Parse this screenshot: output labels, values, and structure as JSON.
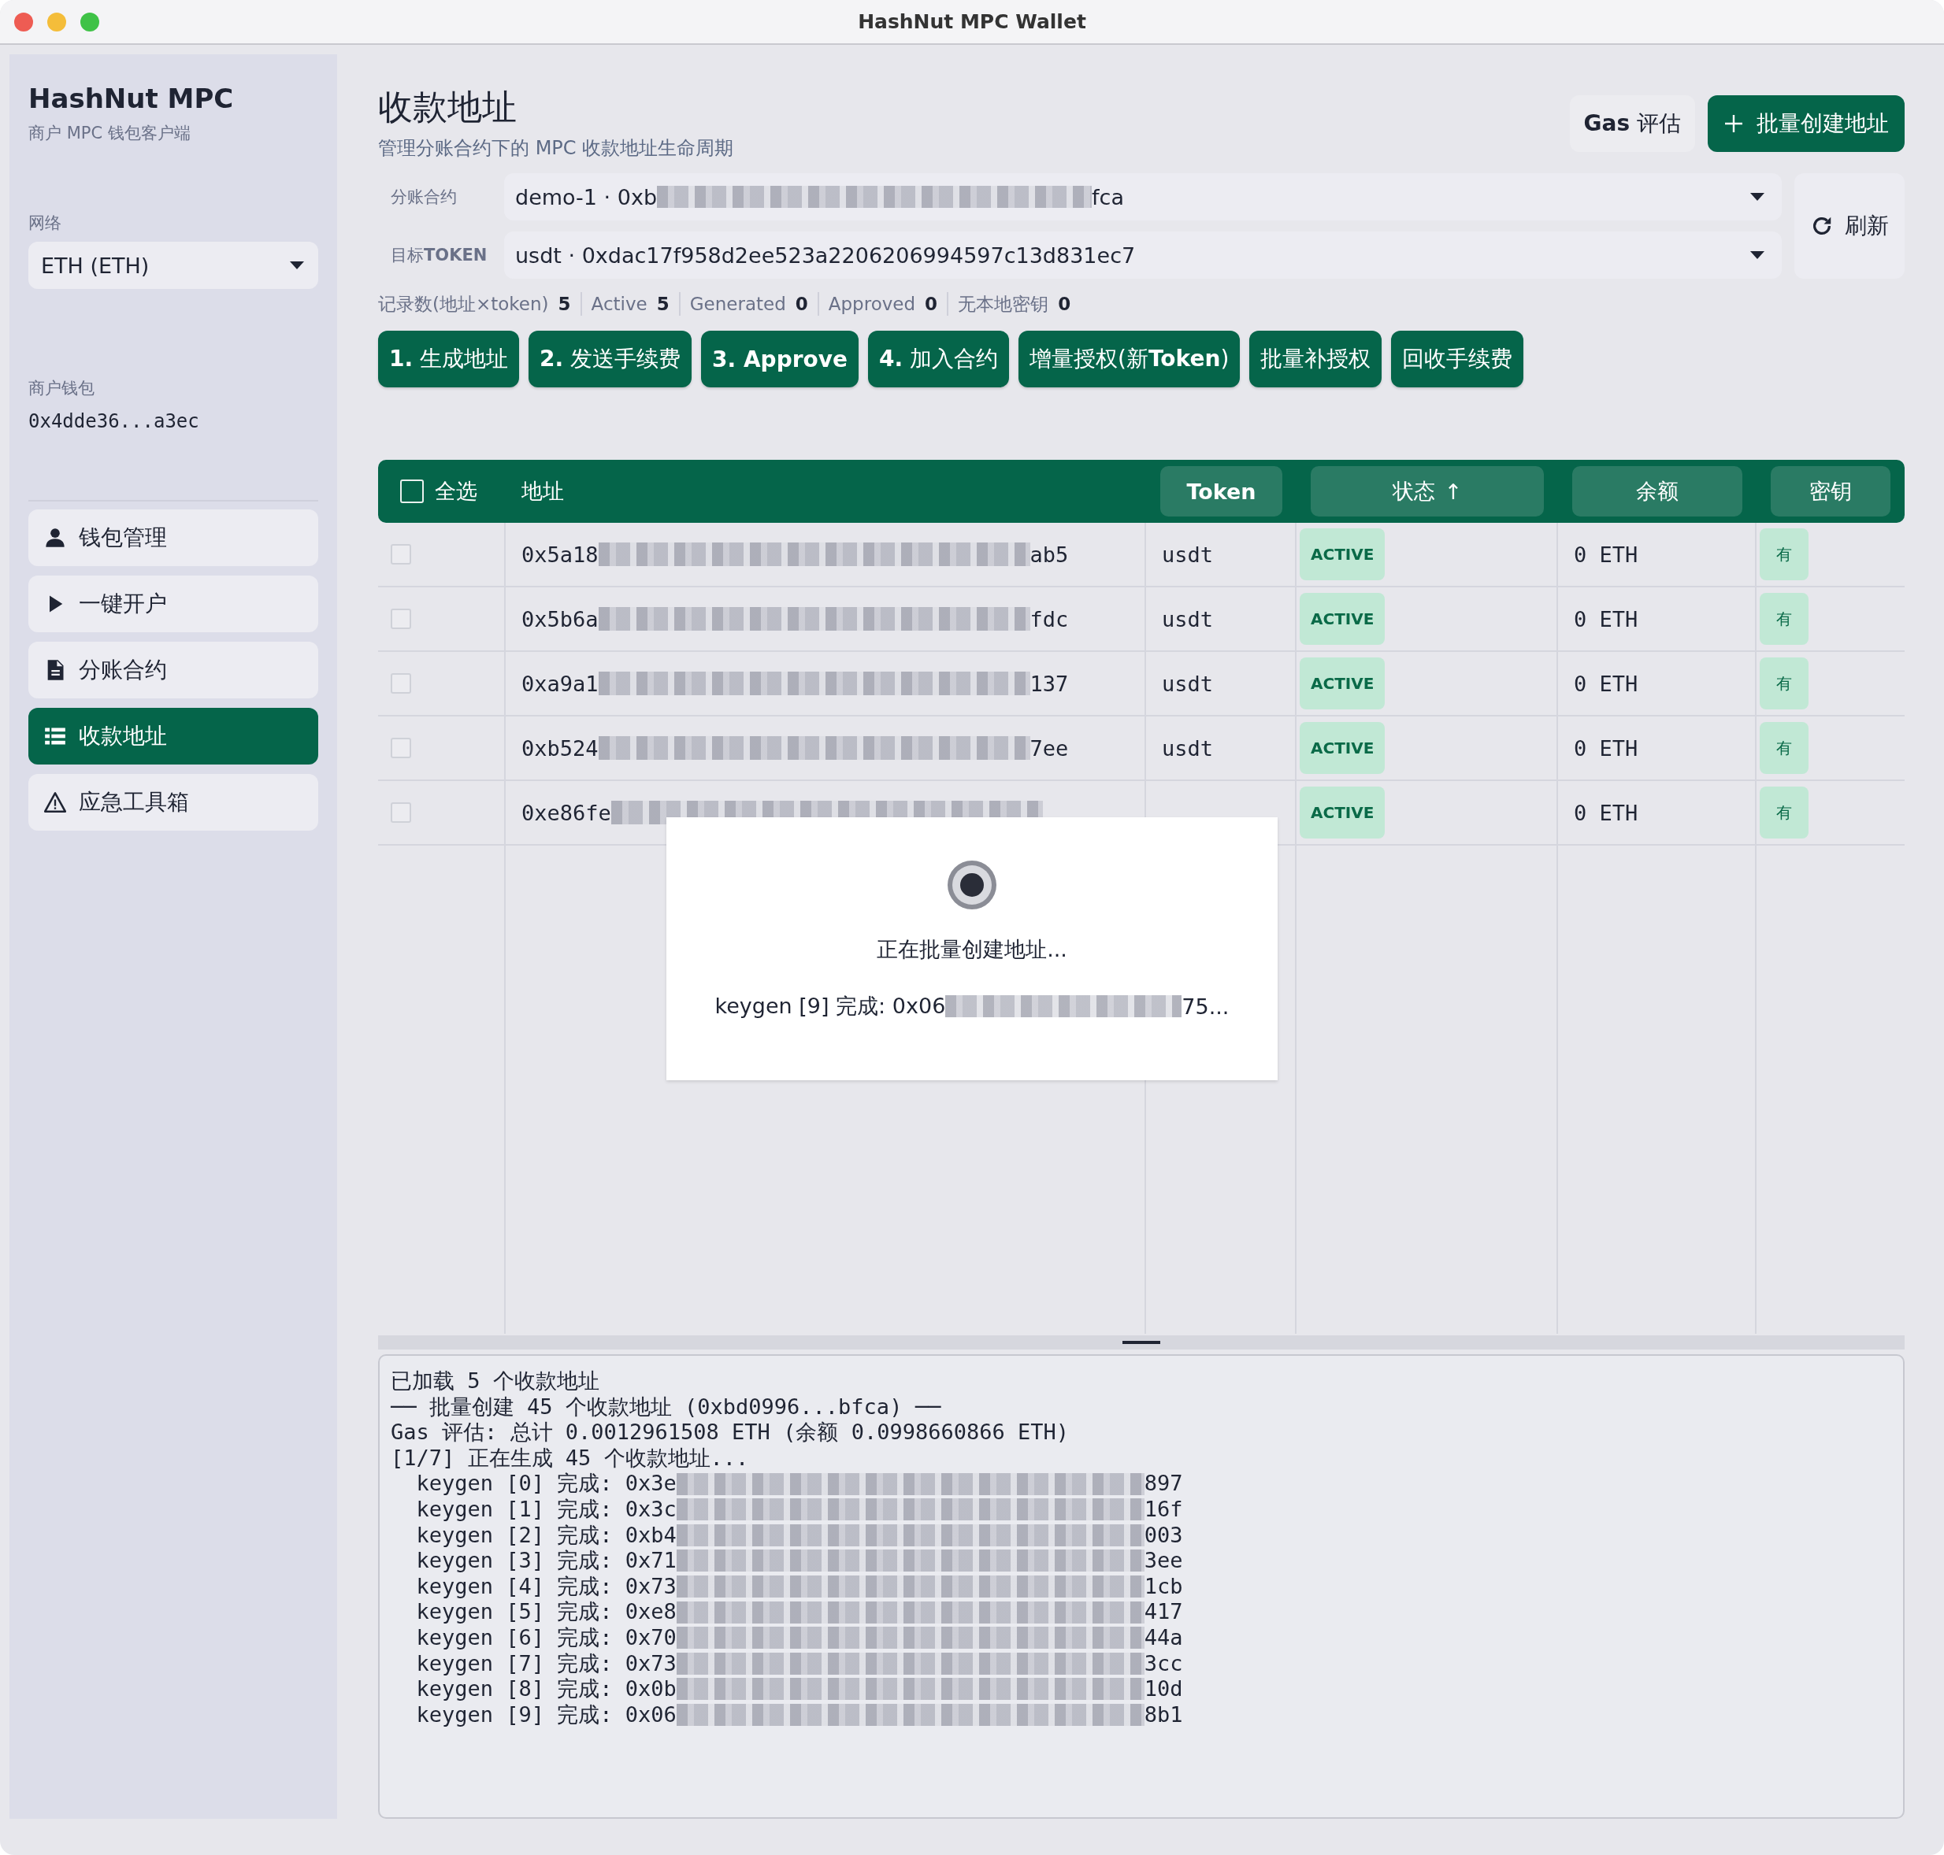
{
  "window": {
    "title": "HashNut MPC Wallet"
  },
  "sidebar": {
    "app_name": "HashNut MPC",
    "app_subtitle": "商户 MPC 钱包客户端",
    "network_label": "网络",
    "network": "ETH (ETH)",
    "wallet_label": "商户钱包",
    "wallet_address": "0x4dde36...a3ec",
    "nav": [
      {
        "label": "钱包管理",
        "selected": false
      },
      {
        "label": "一键开户",
        "selected": false
      },
      {
        "label": "分账合约",
        "selected": false
      },
      {
        "label": "收款地址",
        "selected": true
      },
      {
        "label": "应急工具箱",
        "selected": false
      }
    ]
  },
  "header": {
    "title": "收款地址",
    "subtitle": "管理分账合约下的 MPC 收款地址生命周期",
    "buttons": [
      {
        "label": "**Gas** 评估",
        "kind": "secondary"
      },
      {
        "label": "批量创建地址",
        "kind": "primary"
      }
    ]
  },
  "filters": [
    {
      "label": "分账合约",
      "value_prefix": "demo-1 · 0xb",
      "value_suffix": "fca"
    },
    {
      "label": "目标**TOKEN**",
      "value_prefix": "usdt · 0xdac17f958d2ee523a2206206994597c13d831ec7"
    }
  ],
  "refresh_button": {
    "label": "刷新"
  },
  "stats": [
    {
      "label": "记录数(地址×token)",
      "value": "5"
    },
    {
      "label": "Active",
      "value": "5"
    },
    {
      "label": "Generated",
      "value": "0"
    },
    {
      "label": "Approved",
      "value": "0"
    },
    {
      "label": "无本地密钥",
      "value": "0"
    }
  ],
  "actions": [
    "**1.** 生成地址",
    "**2.** 发送手续费",
    "**3. Approve**",
    "**4.** 加入合约",
    "增量授权(新**Token**)",
    "批量补授权",
    "回收手续费"
  ],
  "table": {
    "select_all": {
      "label": "全选",
      "checked": false
    },
    "columns": [
      {
        "label": "地址",
        "kind": "plain"
      },
      {
        "label": "Token",
        "kind": "sortable"
      },
      {
        "label": "状态",
        "kind": "sortable",
        "sort_mark": "↑"
      },
      {
        "label": "余额",
        "kind": "sortable"
      },
      {
        "label": "密钥",
        "kind": "sortable"
      }
    ],
    "rows": [
      {
        "checked": false,
        "address_prefix": "0x5a18",
        "address_suffix": "ab5",
        "token": "usdt",
        "status": "ACTIVE",
        "balance": "0 ETH",
        "key": "有"
      },
      {
        "checked": false,
        "address_prefix": "0x5b6a",
        "address_suffix": "fdc",
        "token": "usdt",
        "status": "ACTIVE",
        "balance": "0 ETH",
        "key": "有"
      },
      {
        "checked": false,
        "address_prefix": "0xa9a1",
        "address_suffix": "137",
        "token": "usdt",
        "status": "ACTIVE",
        "balance": "0 ETH",
        "key": "有"
      },
      {
        "checked": false,
        "address_prefix": "0xb524",
        "address_suffix": "7ee",
        "token": "usdt",
        "status": "ACTIVE",
        "balance": "0 ETH",
        "key": "有"
      },
      {
        "checked": false,
        "address_prefix": "0xe86fe",
        "status": "ACTIVE",
        "balance": "0 ETH",
        "key": "有"
      }
    ]
  },
  "progress_dialog": {
    "title": "正在批量创建地址...",
    "detail_prefix": "keygen [9] 完成: 0x06",
    "detail_suffix": "75..."
  },
  "log": [
    {
      "text": "已加载 5 个收款地址"
    },
    {
      "text": "── 批量创建 45 个收款地址 (0xbd0996...bfca) ──"
    },
    {
      "text": "Gas 评估: 总计 0.0012961508 ETH (余额 0.0998660866 ETH)"
    },
    {
      "text": "[1/7] 正在生成 45 个收款地址..."
    },
    {
      "text": "  keygen [0] 完成: 0x3e",
      "suffix": "897"
    },
    {
      "text": "  keygen [1] 完成: 0x3c",
      "suffix": "16f"
    },
    {
      "text": "  keygen [2] 完成: 0xb4",
      "suffix": "003"
    },
    {
      "text": "  keygen [3] 完成: 0x71",
      "suffix": "3ee"
    },
    {
      "text": "  keygen [4] 完成: 0x73",
      "suffix": "1cb"
    },
    {
      "text": "  keygen [5] 完成: 0xe8",
      "suffix": "417"
    },
    {
      "text": "  keygen [6] 完成: 0x70",
      "suffix": "44a"
    },
    {
      "text": "  keygen [7] 完成: 0x73",
      "suffix": "3cc"
    },
    {
      "text": "  keygen [8] 完成: 0x0b",
      "suffix": "10d"
    },
    {
      "text": "  keygen [9] 完成: 0x06",
      "suffix": "8b1"
    }
  ]
}
